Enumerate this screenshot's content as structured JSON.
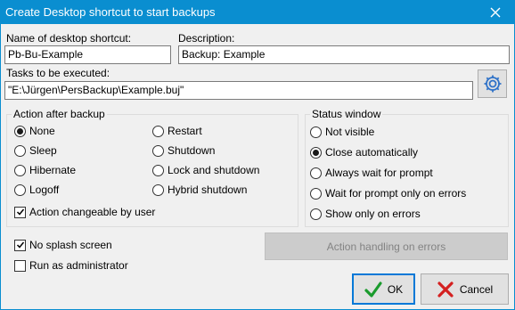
{
  "window": {
    "title": "Create Desktop shortcut to start backups"
  },
  "shortcut_name": {
    "label": "Name of desktop shortcut:",
    "value": "Pb-Bu-Example"
  },
  "description": {
    "label": "Description:",
    "value": "Backup: Example"
  },
  "tasks": {
    "label": "Tasks to be executed:",
    "value": "\"E:\\Jürgen\\PersBackup\\Example.buj\""
  },
  "action_after_backup": {
    "legend": "Action after backup",
    "options": [
      "None",
      "Sleep",
      "Hibernate",
      "Logoff",
      "Restart",
      "Shutdown",
      "Lock and shutdown",
      "Hybrid shutdown"
    ],
    "selected": "None",
    "changeable_label": "Action changeable by user",
    "changeable_checked": true
  },
  "status_window": {
    "legend": "Status window",
    "options": [
      "Not visible",
      "Close automatically",
      "Always wait for prompt",
      "Wait for prompt only on errors",
      "Show only on errors"
    ],
    "selected": "Close automatically"
  },
  "no_splash": {
    "label": "No splash screen",
    "checked": true
  },
  "run_admin": {
    "label": "Run as administrator",
    "checked": false
  },
  "buttons": {
    "action_handling": "Action handling on errors",
    "ok": "OK",
    "cancel": "Cancel"
  },
  "colors": {
    "title_bar": "#0a8ed0",
    "ok_icon": "#1a9b2d",
    "cancel_icon": "#d42020"
  }
}
